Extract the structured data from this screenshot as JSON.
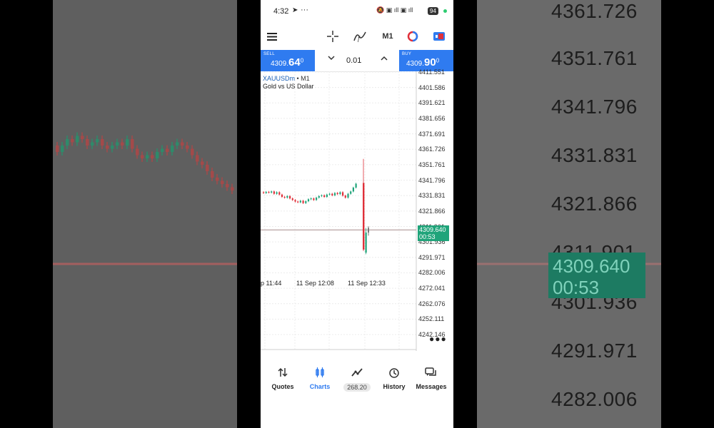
{
  "background": {
    "right_prices": [
      "4361.726",
      "4351.761",
      "4341.796",
      "4331.831",
      "4321.866",
      "4311.901",
      "4301.936",
      "4291.971",
      "4282.006"
    ],
    "right_tag": {
      "price": "4309.640",
      "timer": "00:53"
    }
  },
  "status_bar": {
    "time": "4:32",
    "battery": "94"
  },
  "toolbar": {
    "menu_icon": "hamburger-menu-icon",
    "crosshair_icon": "crosshair-icon",
    "indicators_icon": "indicator-f-icon",
    "timeframe": "M1",
    "objects_icon": "shapes-icon",
    "trade_icon": "trade-icon"
  },
  "trade_bar": {
    "sell_label": "SELL",
    "sell_price_small": "4309.",
    "sell_price_big": "64",
    "sell_price_sup": "0",
    "buy_label": "BUY",
    "buy_price_small": "4309.",
    "buy_price_big": "90",
    "buy_price_sup": "0",
    "lot": "0.01"
  },
  "chart": {
    "symbol": "XAUUSDm",
    "timeframe": "• M1",
    "description": "Gold vs US Dollar",
    "y_ticks": [
      "4411.551",
      "4401.586",
      "4391.621",
      "4381.656",
      "4371.691",
      "4361.726",
      "4351.761",
      "4341.796",
      "4331.831",
      "4321.866",
      "4311.901",
      "4301.936",
      "4291.971",
      "4282.006",
      "4272.041",
      "4262.076",
      "4252.111",
      "4242.146"
    ],
    "current_price": "4309.640",
    "countdown": "00:53",
    "x_ticks": [
      "p 11:44",
      "11 Sep 12:08",
      "11 Sep 12:33"
    ]
  },
  "colors": {
    "accent": "#2f7bf0",
    "bull": "#20a47a",
    "bear": "#e0303a",
    "price_line": "#b9a3a3"
  },
  "bottom_nav": {
    "items": [
      {
        "label": "Quotes",
        "icon": "up-down-arrows-icon"
      },
      {
        "label": "Charts",
        "icon": "candles-icon"
      },
      {
        "label": "268.20",
        "icon": "trend-line-icon"
      },
      {
        "label": "History",
        "icon": "history-clock-icon"
      },
      {
        "label": "Messages",
        "icon": "messages-icon"
      }
    ]
  }
}
